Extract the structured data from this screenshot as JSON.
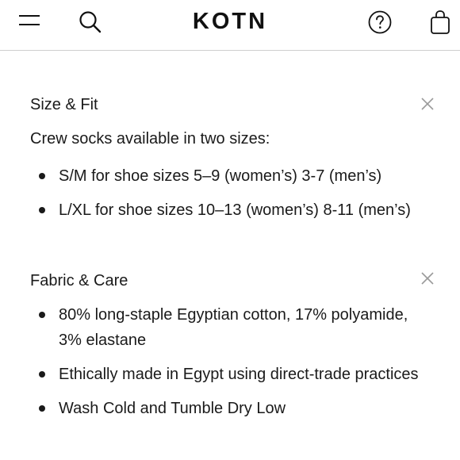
{
  "header": {
    "logo": "KOTN"
  },
  "size_fit": {
    "title": "Size & Fit",
    "intro": "Crew socks available in two sizes:",
    "bullets": [
      "S/M for shoe sizes 5–9 (women’s) 3-7 (men’s)",
      "L/XL for shoe sizes 10–13 (women’s) 8-11 (men’s)"
    ]
  },
  "fabric_care": {
    "title": "Fabric & Care",
    "bullets": [
      "80% long-staple Egyptian cotton, 17% polyamide, 3% elastane",
      "Ethically made in Egypt using direct-trade practices",
      "Wash Cold and Tumble Dry Low"
    ]
  },
  "icons": {
    "menu": "menu-icon",
    "search": "search-icon",
    "help": "help-circle-icon",
    "bag": "shopping-bag-icon",
    "close": "close-icon"
  }
}
